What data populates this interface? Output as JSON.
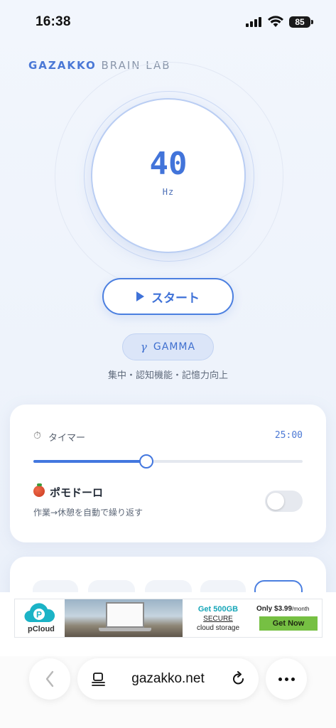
{
  "status_bar": {
    "time": "16:38",
    "battery": "85"
  },
  "brand": {
    "part1": "GAZAKKO",
    "part2": "BRAIN LAB"
  },
  "frequency": {
    "value": "40",
    "unit": "Hz"
  },
  "start_button": {
    "label": "スタート"
  },
  "wave": {
    "symbol": "γ",
    "name": "GAMMA",
    "description": "集中・認知機能・記憶力向上"
  },
  "timer": {
    "icon": "⏱",
    "label": "タイマー",
    "value": "25:00",
    "slider_fraction": 0.42
  },
  "pomodoro": {
    "label": "ポモドーロ",
    "description": "作業→休憩を自動で繰り返す",
    "enabled": false
  },
  "ad": {
    "brand": "pCloud",
    "headline": "Get 500GB",
    "line2": "SECURE",
    "line3": "cloud storage",
    "price": "Only $3.99",
    "price_unit": "/month",
    "cta": "Get Now"
  },
  "browser": {
    "url": "gazakko.net"
  },
  "colors": {
    "accent": "#4377df",
    "background": "#eef3fb"
  }
}
